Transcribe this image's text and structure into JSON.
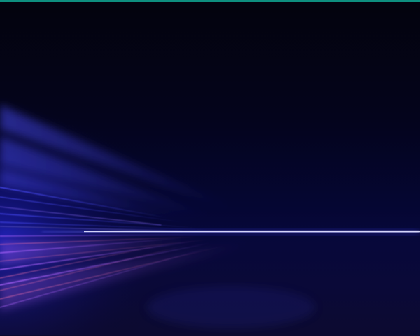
{
  "wallpaper": {
    "subject": "light-streaks",
    "colors": {
      "background_top": "#03030d",
      "background_mid": "#050633",
      "horizon_line": "#8a8cff",
      "streak_blue": "#3a3cff",
      "streak_violet": "#a455ff",
      "streak_pink": "#e15aa8",
      "accent_bar": "#0e8f7f"
    }
  }
}
